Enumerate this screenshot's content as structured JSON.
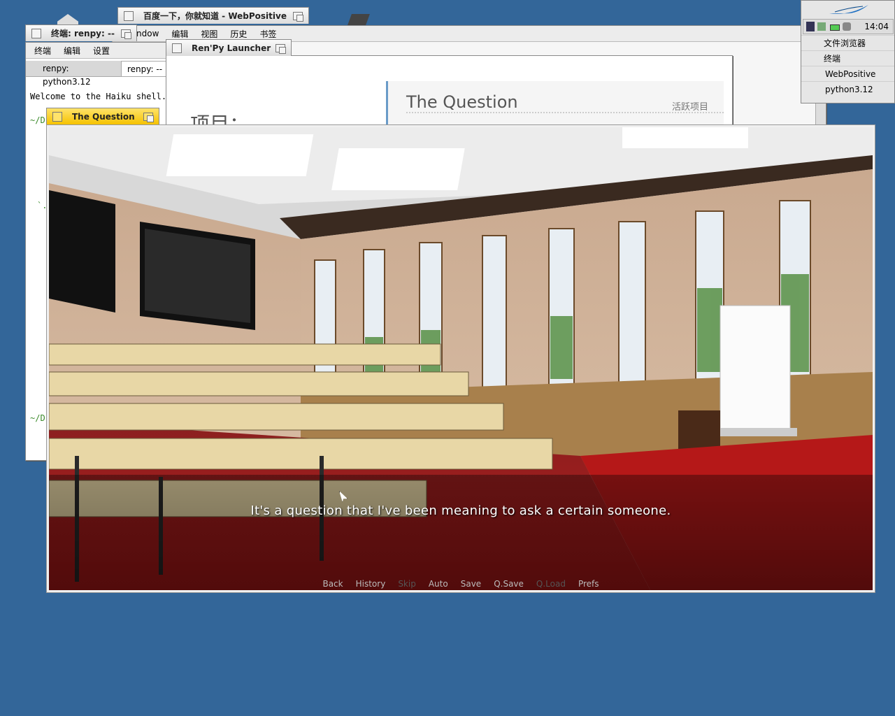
{
  "desktop": {
    "background": "#336699"
  },
  "windows": {
    "terminal": {
      "title": "终端: renpy: --",
      "menu": [
        "终端",
        "编辑",
        "设置"
      ],
      "tabs": [
        "renpy: python3.12",
        "renpy: --"
      ],
      "line1": "Welcome to the Haiku shell.",
      "prompt1": "~/D",
      "prompt2": "~/D",
      "prompt_mark": "`."
    },
    "webpositive": {
      "title": "百度一下，你就知道 - WebPositive",
      "menu": [
        "ndow",
        "编辑",
        "视图",
        "历史",
        "书签"
      ]
    },
    "launcher": {
      "title": "Ren'Py Launcher",
      "projects_heading": "项目：",
      "project_name": "The Question",
      "active_label": "活跃项目"
    },
    "game": {
      "title": "The Question",
      "dialogue": "It's a question that I've been meaning to ask a certain someone.",
      "quick_menu": [
        {
          "label": "Back",
          "enabled": true
        },
        {
          "label": "History",
          "enabled": true
        },
        {
          "label": "Skip",
          "enabled": false
        },
        {
          "label": "Auto",
          "enabled": true
        },
        {
          "label": "Save",
          "enabled": true
        },
        {
          "label": "Q.Save",
          "enabled": true
        },
        {
          "label": "Q.Load",
          "enabled": false
        },
        {
          "label": "Prefs",
          "enabled": true
        }
      ]
    }
  },
  "deskbar": {
    "clock": "14:04",
    "items": [
      "文件浏览器",
      "终端",
      "WebPositive",
      "python3.12"
    ]
  }
}
